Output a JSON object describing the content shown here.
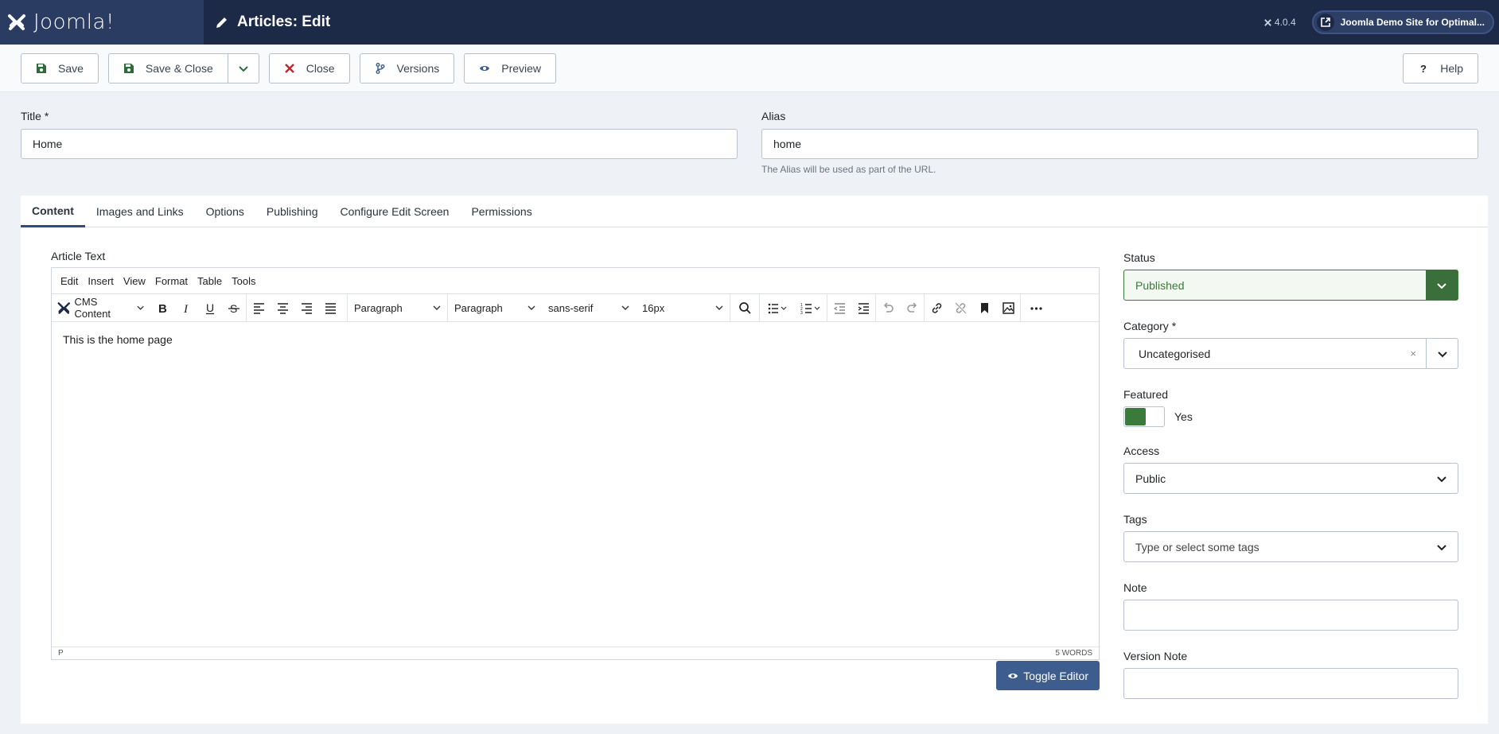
{
  "header": {
    "logo_text": "Joomla!",
    "page_title": "Articles: Edit",
    "version": "4.0.4",
    "site_link": "Joomla Demo Site for Optimal..."
  },
  "toolbar": {
    "save": "Save",
    "save_close": "Save & Close",
    "close": "Close",
    "versions": "Versions",
    "preview": "Preview",
    "help": "Help"
  },
  "form": {
    "title_label": "Title *",
    "title_value": "Home",
    "alias_label": "Alias",
    "alias_value": "home",
    "alias_hint": "The Alias will be used as part of the URL."
  },
  "tabs": [
    "Content",
    "Images and Links",
    "Options",
    "Publishing",
    "Configure Edit Screen",
    "Permissions"
  ],
  "editor": {
    "label": "Article Text",
    "menu": [
      "Edit",
      "Insert",
      "View",
      "Format",
      "Table",
      "Tools"
    ],
    "cms_content": "CMS Content",
    "block_format": "Paragraph",
    "paragraph": "Paragraph",
    "font_family": "sans-serif",
    "font_size": "16px",
    "body_text": "This is the home page",
    "status_path": "P",
    "word_count": "5 WORDS",
    "toggle": "Toggle Editor"
  },
  "sidebar": {
    "status_label": "Status",
    "status_value": "Published",
    "category_label": "Category *",
    "category_value": "Uncategorised",
    "featured_label": "Featured",
    "featured_value": "Yes",
    "access_label": "Access",
    "access_value": "Public",
    "tags_label": "Tags",
    "tags_placeholder": "Type or select some tags",
    "note_label": "Note",
    "version_note_label": "Version Note"
  }
}
